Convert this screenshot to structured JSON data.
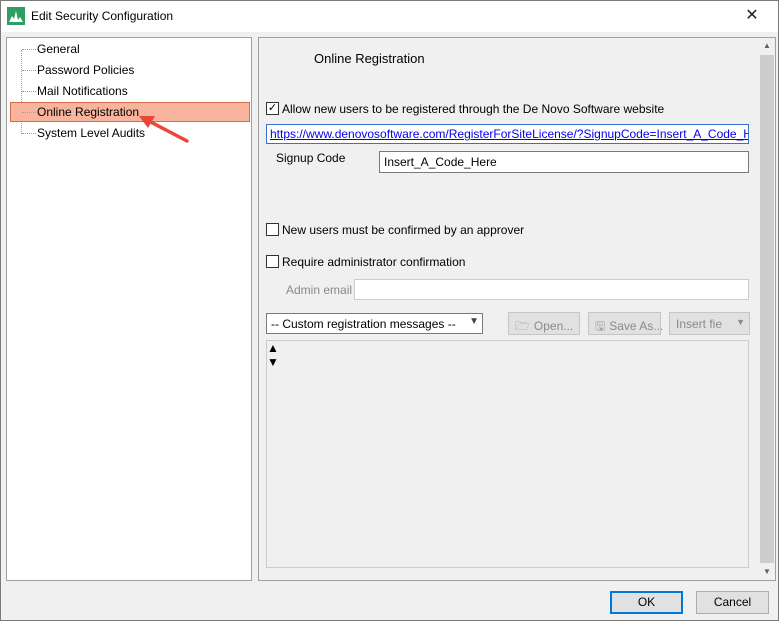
{
  "window": {
    "title": "Edit Security Configuration",
    "close_glyph": "✕"
  },
  "tree": {
    "items": [
      {
        "label": "General",
        "selected": false
      },
      {
        "label": "Password Policies",
        "selected": false
      },
      {
        "label": "Mail Notifications",
        "selected": false
      },
      {
        "label": "Online Registration",
        "selected": true
      },
      {
        "label": "System Level Audits",
        "selected": false
      }
    ]
  },
  "panel": {
    "title": "Online Registration",
    "allow_registration": {
      "label": "Allow new users to be registered through the De Novo Software website",
      "checked": true,
      "mark": "✓"
    },
    "registration_url": "https://www.denovosoftware.com/RegisterForSiteLicense/?SignupCode=Insert_A_Code_Here",
    "signup_code": {
      "label": "Signup Code",
      "value": "Insert_A_Code_Here"
    },
    "approver_confirm": {
      "label": "New users must be confirmed by an approver",
      "checked": false
    },
    "admin_confirm": {
      "label": "Require administrator confirmation",
      "checked": false
    },
    "admin_email": {
      "label": "Admin email",
      "value": ""
    },
    "messages_select": {
      "value": "-- Custom registration messages --"
    },
    "open_button": "Open...",
    "save_as_button": "Save As...",
    "insert_field_button": "Insert fie"
  },
  "footer": {
    "ok_label": "OK",
    "cancel_label": "Cancel"
  },
  "colors": {
    "selection_bg": "#f8b49c",
    "selection_border": "#d46b4a",
    "annotation_arrow": "#e8473a",
    "link": "#0000ee",
    "primary_border": "#0078d7"
  }
}
